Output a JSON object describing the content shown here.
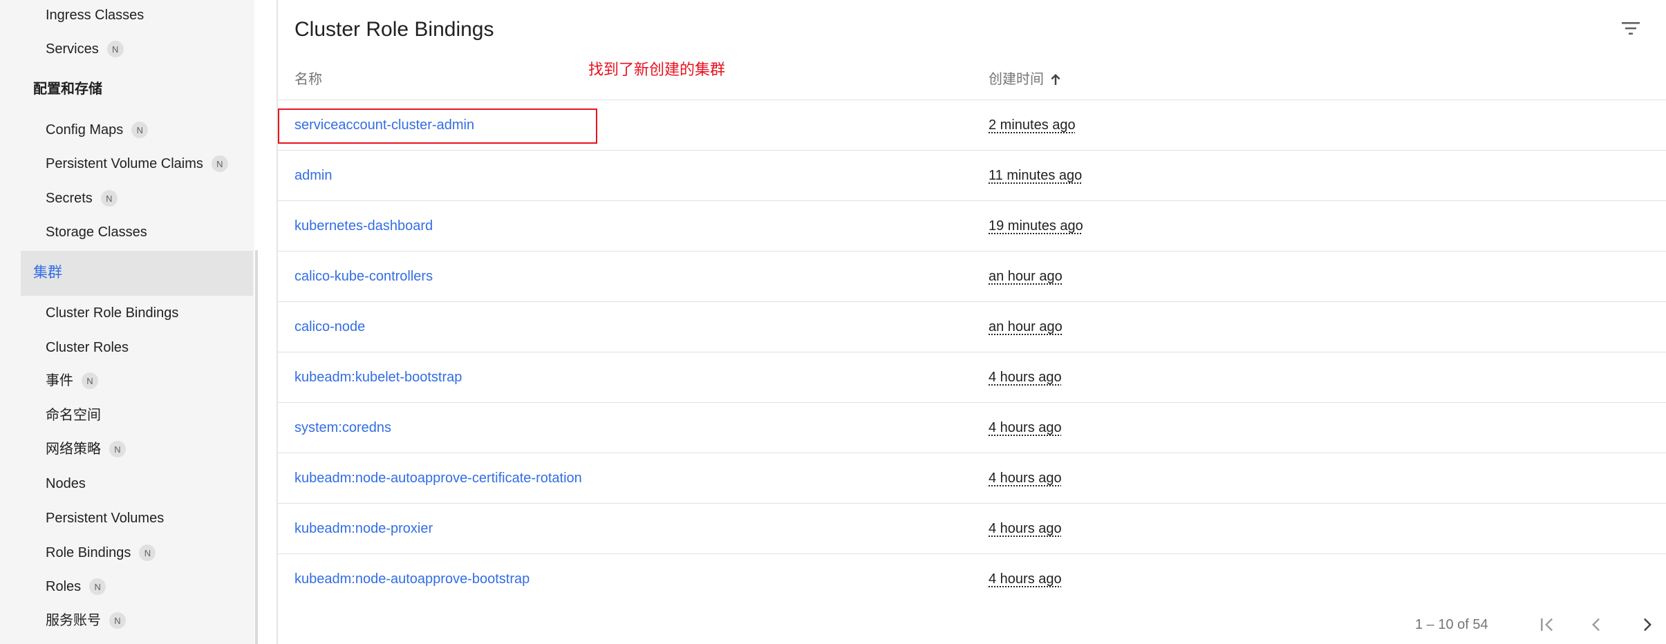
{
  "sidebar": {
    "items_top": [
      {
        "label": "Ingress Classes",
        "badge": ""
      },
      {
        "label": "Services",
        "badge": "N"
      }
    ],
    "section_config": "配置和存储",
    "config_items": [
      {
        "label": "Config Maps",
        "badge": "N"
      },
      {
        "label": "Persistent Volume Claims",
        "badge": "N"
      },
      {
        "label": "Secrets",
        "badge": "N"
      },
      {
        "label": "Storage Classes",
        "badge": ""
      }
    ],
    "section_cluster": "集群",
    "cluster_items": [
      {
        "label": "Cluster Role Bindings",
        "badge": ""
      },
      {
        "label": "Cluster Roles",
        "badge": ""
      },
      {
        "label": "事件",
        "badge": "N"
      },
      {
        "label": "命名空间",
        "badge": ""
      },
      {
        "label": "网络策略",
        "badge": "N"
      },
      {
        "label": "Nodes",
        "badge": ""
      },
      {
        "label": "Persistent Volumes",
        "badge": ""
      },
      {
        "label": "Role Bindings",
        "badge": "N"
      },
      {
        "label": "Roles",
        "badge": "N"
      },
      {
        "label": "服务账号",
        "badge": "N"
      }
    ]
  },
  "main": {
    "title": "Cluster Role Bindings",
    "annotation": "找到了新创建的集群",
    "columns": {
      "name": "名称",
      "created": "创建时间"
    },
    "rows": [
      {
        "name": "serviceaccount-cluster-admin",
        "age": "2 minutes ago"
      },
      {
        "name": "admin",
        "age": "11 minutes ago"
      },
      {
        "name": "kubernetes-dashboard",
        "age": "19 minutes ago"
      },
      {
        "name": "calico-kube-controllers",
        "age": "an hour ago"
      },
      {
        "name": "calico-node",
        "age": "an hour ago"
      },
      {
        "name": "kubeadm:kubelet-bootstrap",
        "age": "4 hours ago"
      },
      {
        "name": "system:coredns",
        "age": "4 hours ago"
      },
      {
        "name": "kubeadm:node-autoapprove-certificate-rotation",
        "age": "4 hours ago"
      },
      {
        "name": "kubeadm:node-proxier",
        "age": "4 hours ago"
      },
      {
        "name": "kubeadm:node-autoapprove-bootstrap",
        "age": "4 hours ago"
      }
    ],
    "paginator": {
      "range": "1 – 10 of 54"
    }
  },
  "colors": {
    "accent": "#326de6",
    "annotation": "#e8121f"
  }
}
